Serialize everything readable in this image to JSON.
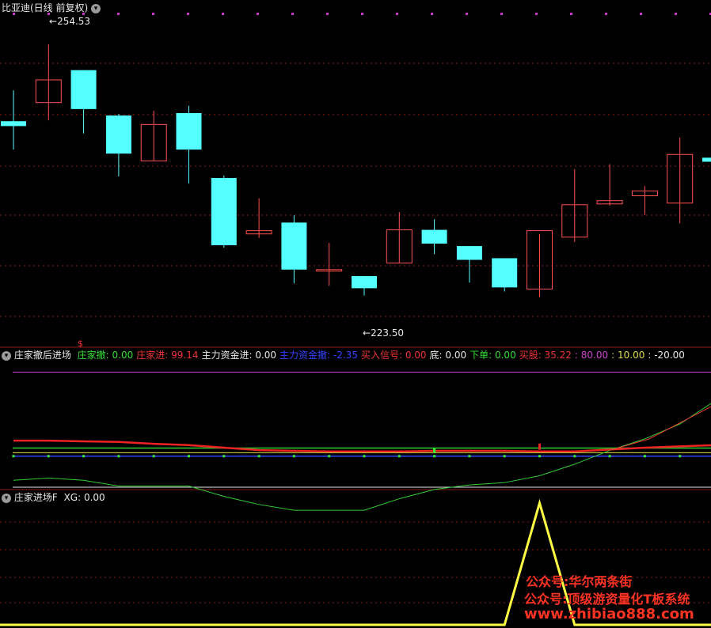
{
  "panel1": {
    "title": "比亚迪(日线 前复权)",
    "high_label": "254.53",
    "low_label": "223.50",
    "marker_label": "$"
  },
  "panel2": {
    "title": "庄家撤后进场",
    "items": [
      {
        "key": "庄家撤:",
        "value": "0.00",
        "color": "#33dd33"
      },
      {
        "key": "庄家进:",
        "value": "99.14",
        "color": "#ee3333"
      },
      {
        "key": "主力资金进:",
        "value": "0.00",
        "color": "#e8e8e8"
      },
      {
        "key": "主力资金撤:",
        "value": "-2.35",
        "color": "#3344ff"
      },
      {
        "key": "买入信号:",
        "value": "0.00",
        "color": "#ee3333"
      },
      {
        "key": "底:",
        "value": "0.00",
        "color": "#e8e8e8"
      },
      {
        "key": "下单:",
        "value": "0.00",
        "color": "#33dd33"
      },
      {
        "key": "买股:",
        "value": "35.22",
        "color": "#ee3333"
      },
      {
        "key": ":",
        "value": "80.00",
        "color": "#cc44cc"
      },
      {
        "key": ":",
        "value": "10.00",
        "color": "#dddd44"
      },
      {
        "key": ":",
        "value": "-20.00",
        "color": "#e8e8e8"
      }
    ]
  },
  "panel3": {
    "title": "庄家进场F",
    "items": [
      {
        "key": "XG:",
        "value": "0.00",
        "color": "#e8e8e8"
      }
    ]
  },
  "watermark": {
    "line1": "公众号:华尔两条街",
    "line2": "公众号:顶级游资量化T板系统",
    "line3": "www.zhibiao888.com"
  },
  "colors": {
    "up": "#ff5050",
    "down": "#54ffff",
    "grid": "#8b1a1a",
    "magenta_dot": "#cc33cc",
    "xg_line": "#ffff44",
    "watermark": "#ff3322"
  },
  "chart_data": {
    "type": "candlestick",
    "price_range": [
      218,
      258
    ],
    "candles": [
      {
        "o": 245.0,
        "h": 248.8,
        "l": 241.5,
        "c": 244.4
      },
      {
        "o": 247.3,
        "h": 254.5,
        "l": 245.1,
        "c": 250.1
      },
      {
        "o": 251.3,
        "h": 251.3,
        "l": 243.5,
        "c": 246.5
      },
      {
        "o": 245.7,
        "h": 245.9,
        "l": 238.2,
        "c": 241.0
      },
      {
        "o": 240.1,
        "h": 246.3,
        "l": 240.1,
        "c": 244.6
      },
      {
        "o": 246.0,
        "h": 246.9,
        "l": 237.3,
        "c": 241.5
      },
      {
        "o": 238.0,
        "h": 238.3,
        "l": 229.4,
        "c": 229.7
      },
      {
        "o": 231.1,
        "h": 235.5,
        "l": 230.6,
        "c": 231.5
      },
      {
        "o": 232.5,
        "h": 233.4,
        "l": 225.0,
        "c": 226.7
      },
      {
        "o": 226.7,
        "h": 230.0,
        "l": 224.7,
        "c": 226.7
      },
      {
        "o": 225.9,
        "h": 225.9,
        "l": 223.5,
        "c": 224.4
      },
      {
        "o": 227.5,
        "h": 233.8,
        "l": 227.5,
        "c": 231.6
      },
      {
        "o": 231.6,
        "h": 232.9,
        "l": 228.6,
        "c": 229.9
      },
      {
        "o": 229.6,
        "h": 229.6,
        "l": 225.1,
        "c": 227.9
      },
      {
        "o": 228.1,
        "h": 228.1,
        "l": 224.0,
        "c": 224.5
      },
      {
        "o": 224.3,
        "h": 231.1,
        "l": 223.3,
        "c": 231.5
      },
      {
        "o": 230.7,
        "h": 239.1,
        "l": 230.1,
        "c": 234.7
      },
      {
        "o": 234.8,
        "h": 239.7,
        "l": 234.6,
        "c": 235.2
      },
      {
        "o": 235.8,
        "h": 237.0,
        "l": 233.4,
        "c": 236.4
      },
      {
        "o": 234.9,
        "h": 243.0,
        "l": 232.4,
        "c": 240.9
      },
      {
        "o": 240.5,
        "h": 240.5,
        "l": 240.0,
        "c": 240.0
      }
    ],
    "oscillator": {
      "range": [
        -20,
        90
      ],
      "levels": [
        80,
        10,
        -20
      ],
      "zhuangjin": [
        99,
        99,
        98,
        97,
        94,
        92,
        88,
        84,
        83,
        82,
        82,
        82,
        83,
        83,
        83,
        82,
        82,
        85,
        88,
        90,
        92
      ],
      "green_line": [
        -14,
        -12,
        -14,
        -19,
        -19,
        -19,
        -28,
        -35,
        -40,
        -40,
        -40,
        -30,
        -22,
        -18,
        -16,
        -10,
        0,
        12,
        22,
        35,
        55
      ]
    },
    "xg": {
      "range": [
        0,
        1
      ],
      "values": [
        0,
        0,
        0,
        0,
        0,
        0,
        0,
        0,
        0,
        0,
        0,
        0,
        0,
        0,
        0,
        1,
        0,
        0,
        0,
        0,
        0
      ]
    }
  }
}
